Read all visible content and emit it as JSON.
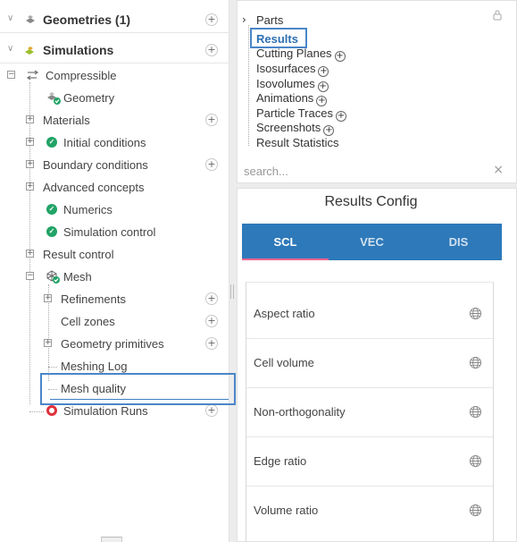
{
  "tree": {
    "geometries": {
      "label": "Geometries (1)"
    },
    "simulations": {
      "label": "Simulations"
    },
    "compressible": {
      "label": "Compressible"
    },
    "items": {
      "geometry": "Geometry",
      "materials": "Materials",
      "initial_conditions": "Initial conditions",
      "boundary_conditions": "Boundary conditions",
      "advanced_concepts": "Advanced concepts",
      "numerics": "Numerics",
      "simulation_control": "Simulation control",
      "result_control": "Result control",
      "mesh": "Mesh",
      "refinements": "Refinements",
      "cell_zones": "Cell zones",
      "geometry_primitives": "Geometry primitives",
      "meshing_log": "Meshing Log",
      "mesh_quality": "Mesh quality",
      "simulation_runs": "Simulation Runs"
    }
  },
  "results_tree": {
    "items": [
      "Parts",
      "Results",
      "Cutting Planes",
      "Isosurfaces",
      "Isovolumes",
      "Animations",
      "Particle Traces",
      "Screenshots",
      "Result Statistics"
    ],
    "search_placeholder": "search..."
  },
  "results_config": {
    "title": "Results Config",
    "tabs": [
      "SCL",
      "VEC",
      "DIS"
    ],
    "active_tab": "SCL",
    "list": [
      "Aspect ratio",
      "Cell volume",
      "Non-orthogonality",
      "Edge ratio",
      "Volume ratio"
    ]
  },
  "colors": {
    "accent": "#2e79b9",
    "selection": "#4a86c8",
    "success": "#21a366",
    "error": "#e0303c",
    "tab_underline": "#f06292"
  }
}
